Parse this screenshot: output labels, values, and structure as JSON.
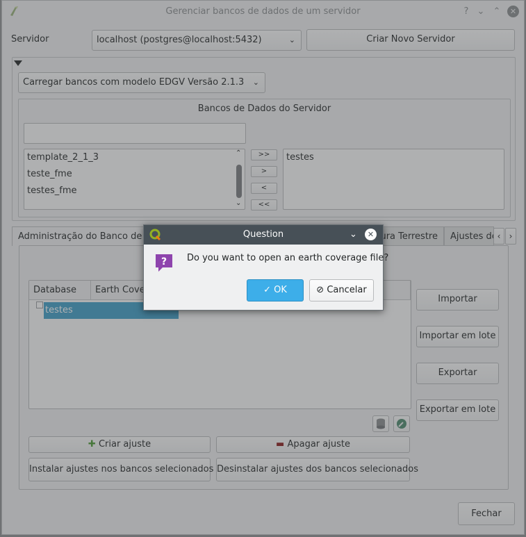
{
  "window": {
    "title": "Gerenciar bancos de dados de um servidor"
  },
  "server": {
    "label": "Servidor",
    "selected": "localhost (postgres@localhost:5432)",
    "create_button": "Criar Novo Servidor"
  },
  "load": {
    "selected": "Carregar bancos com modelo EDGV Versão 2.1.3"
  },
  "dbgroup": {
    "title": "Bancos de Dados do Servidor",
    "search_value": "",
    "available": [
      "template_2_1_3",
      "teste_fme",
      "testes_fme"
    ],
    "selected": [
      "testes"
    ],
    "move_all_right": ">>",
    "move_right": ">",
    "move_left": "<",
    "move_all_left": "<<"
  },
  "tabs": [
    {
      "label": "Administração do Banco de Dados"
    },
    {
      "label": "Cobertura Terrestre"
    },
    {
      "label": "Ajustes de banco"
    }
  ],
  "coverage": {
    "columns": [
      "Database",
      "Earth Coverage"
    ],
    "rows": [
      "testes"
    ],
    "import_button": "Importar",
    "batch_import_button": "Importar em lote",
    "export_button": "Exportar",
    "batch_export_button": "Exportar em lote"
  },
  "adjust": {
    "create_button": "Criar ajuste",
    "delete_button": "Apagar ajuste",
    "install_button": "Instalar ajustes nos bancos selecionados",
    "uninstall_button": "Desinstalar ajustes dos bancos selecionados"
  },
  "footer": {
    "close_button": "Fechar"
  },
  "dialog": {
    "title": "Question",
    "message": "Do you want to open an earth coverage file?",
    "ok_button": "OK",
    "cancel_button": "Cancelar"
  },
  "colors": {
    "accent": "#3daee9",
    "dialog_title_bg": "#475057",
    "question_icon": "#8e44ad",
    "selection": "#3f9fc9"
  }
}
